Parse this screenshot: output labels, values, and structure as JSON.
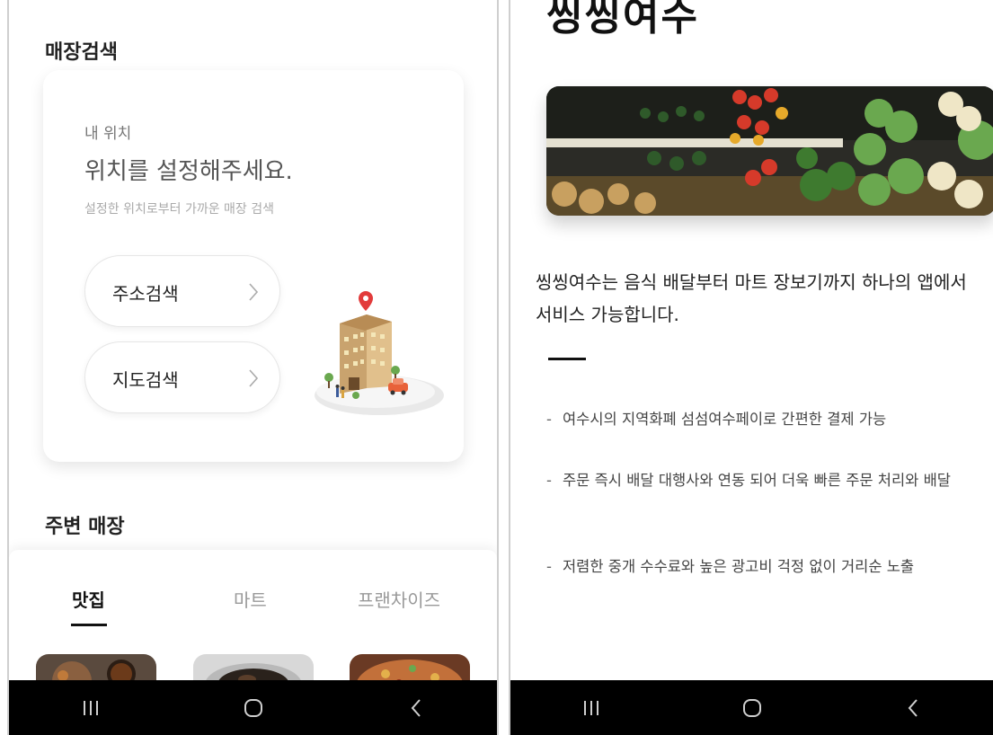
{
  "left": {
    "store_search_title": "매장검색",
    "location_card": {
      "label": "내 위치",
      "heading": "위치를 설정해주세요.",
      "description": "설정한 위치로부터 가까운 매장 검색",
      "address_search_label": "주소검색",
      "map_search_label": "지도검색",
      "arrow_glyph": ">"
    },
    "nearby_title": "주변 매장",
    "tabs": [
      {
        "label": "맛집",
        "active": true
      },
      {
        "label": "마트",
        "active": false
      },
      {
        "label": "프랜차이즈",
        "active": false
      }
    ]
  },
  "right": {
    "title": "씽씽여수",
    "intro": "씽씽여수는 음식 배달부터 마트 장보기까지 하나의 앱에서 서비스 가능합니다.",
    "bullets": [
      "여수시의 지역화폐 섬섬여수페이로 간편한 결제 가능",
      "주문 즉시 배달 대행사와 연동 되어 더욱 빠른 주문 처리와 배달",
      "저렴한 중개 수수료와 높은 광고비 걱정 없이 거리순 노출"
    ],
    "bullet_marker": "-"
  },
  "navbar": {
    "icons": [
      "recent-apps-icon",
      "home-icon",
      "back-icon"
    ],
    "background": "#000000"
  },
  "colors": {
    "location_pin": "#e23b3b",
    "text_primary": "#222222",
    "text_muted": "#999999"
  }
}
